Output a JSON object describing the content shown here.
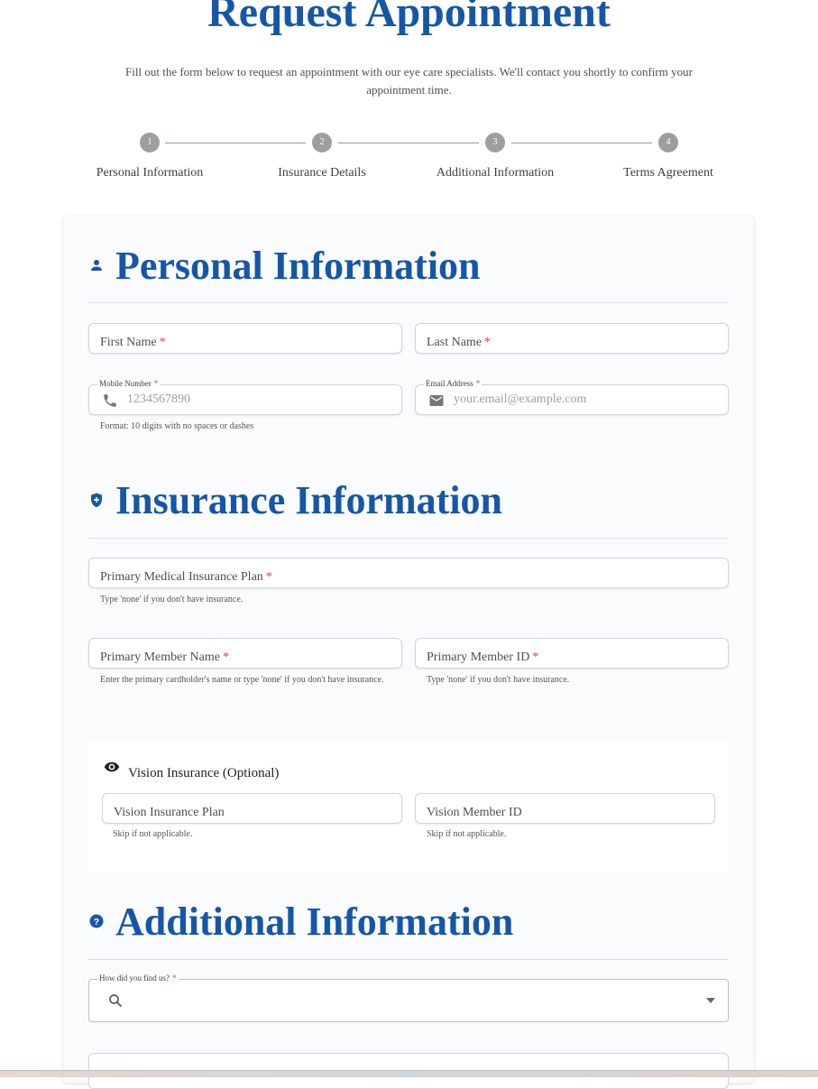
{
  "header": {
    "title": "Request Appointment",
    "subtitle": "Fill out the form below to request an appointment with our eye care specialists. We'll contact you shortly to confirm your appointment time."
  },
  "steps": [
    {
      "number": "1",
      "label": "Personal Information"
    },
    {
      "number": "2",
      "label": "Insurance Details"
    },
    {
      "number": "3",
      "label": "Additional Information"
    },
    {
      "number": "4",
      "label": "Terms Agreement"
    }
  ],
  "personal": {
    "heading": "Personal Information",
    "icon": "person-icon",
    "first_name": "First Name",
    "last_name": "Last Name",
    "mobile_label": "Mobile Number",
    "mobile_placeholder": "1234567890",
    "mobile_helper": "Format: 10 digits with no spaces or dashes",
    "email_label": "Email Address",
    "email_placeholder": "your.email@example.com",
    "required_mark": "*"
  },
  "insurance": {
    "heading": "Insurance Information",
    "icon": "shield-plus-icon",
    "primary_plan": "Primary Medical Insurance Plan",
    "primary_plan_helper": "Type 'none' if you don't have insurance.",
    "member_name": "Primary Member Name",
    "member_name_helper": "Enter the primary cardholder's name or type 'none' if you don't have insurance.",
    "member_id": "Primary Member ID",
    "member_id_helper": "Type 'none' if you don't have insurance.",
    "vision": {
      "title": "Vision Insurance (Optional)",
      "icon": "eye-icon",
      "plan": "Vision Insurance Plan",
      "plan_helper": "Skip if not applicable.",
      "member_id": "Vision Member ID",
      "member_id_helper": "Skip if not applicable."
    }
  },
  "additional": {
    "heading": "Additional Information",
    "icon": "help-circle-icon",
    "referral_label": "How did you find us?"
  },
  "colors": {
    "brand_blue": "#1557a6",
    "required_red": "#e53935",
    "step_gray": "#9e9e9e"
  }
}
